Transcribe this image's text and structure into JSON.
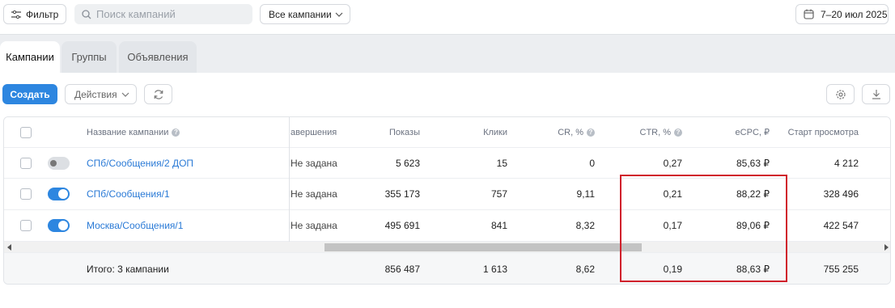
{
  "toolbar": {
    "filter_label": "Фильтр",
    "search_placeholder": "Поиск кампаний",
    "campaigns_select": "Все кампании",
    "date_range": "7–20 июл 2025"
  },
  "tabs": [
    {
      "label": "Кампании",
      "active": true
    },
    {
      "label": "Группы",
      "active": false
    },
    {
      "label": "Объявления",
      "active": false
    }
  ],
  "actions": {
    "create_label": "Создать",
    "actions_label": "Действия"
  },
  "table": {
    "headers": {
      "name": "Название кампании",
      "end": "авершения",
      "impressions": "Показы",
      "clicks": "Клики",
      "cr": "CR, %",
      "ctr": "CTR, %",
      "ecpc": "eCPC, ₽",
      "view_start": "Старт просмотра"
    },
    "rows": [
      {
        "enabled": false,
        "name": "СПб/Сообщения/2 ДОП",
        "end": "Не задана",
        "impressions": "5 623",
        "clicks": "15",
        "cr": "0",
        "ctr": "0,27",
        "ecpc": "85,63 ₽",
        "view_start": "4 212"
      },
      {
        "enabled": true,
        "name": "СПб/Сообщения/1",
        "end": "Не задана",
        "impressions": "355 173",
        "clicks": "757",
        "cr": "9,11",
        "ctr": "0,21",
        "ecpc": "88,22 ₽",
        "view_start": "328 496"
      },
      {
        "enabled": true,
        "name": "Москва/Сообщения/1",
        "end": "Не задана",
        "impressions": "495 691",
        "clicks": "841",
        "cr": "8,32",
        "ctr": "0,17",
        "ecpc": "89,06 ₽",
        "view_start": "422 547"
      }
    ],
    "totals": {
      "label": "Итого: 3 кампании",
      "impressions": "856 487",
      "clicks": "1 613",
      "cr": "8,62",
      "ctr": "0,19",
      "ecpc": "88,63 ₽",
      "view_start": "755 255"
    }
  },
  "colors": {
    "accent": "#2d86e0",
    "highlight": "#d0202b"
  }
}
